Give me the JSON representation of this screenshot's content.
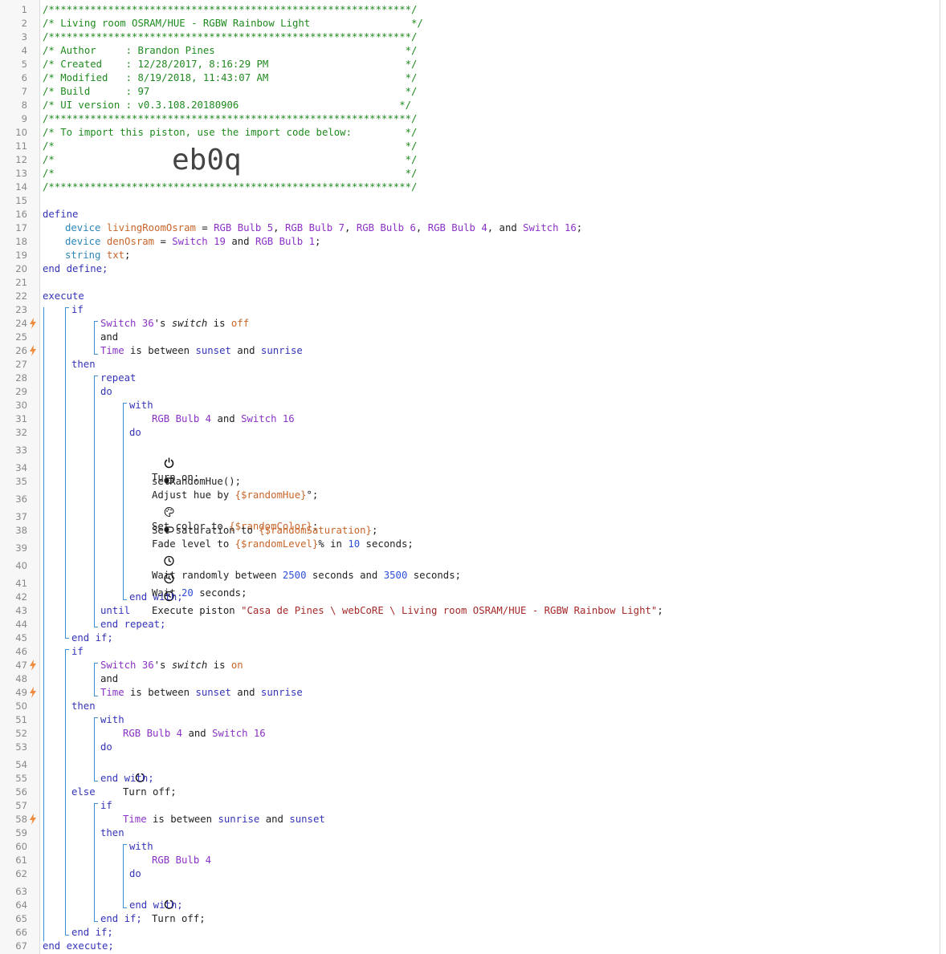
{
  "header": {
    "border": "/*************************************************************/",
    "title_line": "/* Living room OSRAM/HUE - RGBW Rainbow Light                 */",
    "author_line": "/* Author     : Brandon Pines                                */",
    "created_line": "/* Created    : 12/28/2017, 8:16:29 PM                       */",
    "modified_line": "/* Modified   : 8/19/2018, 11:43:07 AM                       */",
    "build_line": "/* Build      : 97                                           */",
    "ui_line": "/* UI version : v0.3.108.20180906                           */",
    "import_line": "/* To import this piston, use the import code below:         */",
    "blank_line": "/*                                                           */",
    "import_code": "eb0q"
  },
  "define": {
    "kw_define": "define",
    "device_kw": "device",
    "var1": "livingRoomOsram",
    "eq": " = ",
    "d_rgb5": "RGB Bulb 5",
    "d_rgb7": "RGB Bulb 7",
    "d_rgb6": "RGB Bulb 6",
    "d_rgb4": "RGB Bulb 4",
    "d_sw16": "Switch 16",
    "d_sw19": "Switch 19",
    "d_rgb1": "RGB Bulb 1",
    "var2": "denOsram",
    "string_kw": "string",
    "var3": "txt",
    "end_define": "end define;",
    "comma": ", ",
    "and_txt": ", and ",
    "and_sp": " and ",
    "semi": ";"
  },
  "body": {
    "execute": "execute",
    "end_execute": "end execute;",
    "if": "if",
    "then": "then",
    "else": "else",
    "end_if": "end if;",
    "and": "and",
    "repeat": "repeat",
    "do": "do",
    "until": "until",
    "end_repeat": "end repeat;",
    "with": "with",
    "end_with": "end with;",
    "sw36": "Switch 36",
    "poss": "'s ",
    "switch_attr": "switch",
    "is": " is ",
    "off": "off",
    "on": "on",
    "time": "Time",
    "is_between": " is between ",
    "sunset": "sunset",
    "sunrise": "sunrise",
    "turn_on": "Turn on;",
    "adjust_hue": "Adjust hue by ",
    "random_hue": "{$randomHue}",
    "deg": "°;",
    "set_random_hue": "setRandomHue();",
    "set_color": "Set color to ",
    "random_color": "{$randomColor}",
    "fade_level": "Fade level to ",
    "random_level": "{$randomLevel}",
    "pct_in": "% in ",
    "n10": "10",
    "seconds_semi": " seconds;",
    "set_saturation": "Set saturation to ",
    "random_saturation": "{$randomSaturation}",
    "wait_randomly": "Wait randomly between ",
    "n2500": "2500",
    "seconds_and": " seconds and ",
    "n3500": "3500",
    "wait": "Wait ",
    "n20": "20",
    "execute_piston": "Execute piston ",
    "piston_name": "\"Casa de Pines \\ webCoRE \\ Living room OSRAM/HUE - RGBW Rainbow Light\"",
    "turn_off": "Turn off;",
    "semi": ";"
  },
  "line_numbers": [
    "1",
    "2",
    "3",
    "4",
    "5",
    "6",
    "7",
    "8",
    "9",
    "10",
    "11",
    "12",
    "13",
    "14",
    "15",
    "16",
    "17",
    "18",
    "19",
    "20",
    "21",
    "22",
    "23",
    "24",
    "25",
    "26",
    "27",
    "28",
    "29",
    "30",
    "31",
    "32",
    "33",
    "34",
    "35",
    "36",
    "37",
    "38",
    "39",
    "40",
    "41",
    "42",
    "43",
    "44",
    "45",
    "46",
    "47",
    "48",
    "49",
    "50",
    "51",
    "52",
    "53",
    "54",
    "55",
    "56",
    "57",
    "58",
    "59",
    "60",
    "61",
    "62",
    "63",
    "64",
    "65",
    "66",
    "67"
  ],
  "colors": {
    "comment": "#1f8a1f",
    "keyword": "#3434b8",
    "device": "#8a32c6",
    "variable": "#c8652a",
    "number": "#2d4fd6",
    "string": "#a62a2a",
    "trigger": "#f08a3c",
    "bracket": "#3b8fd6"
  },
  "trigger_lines": [
    "24",
    "26",
    "47",
    "49",
    "58"
  ]
}
